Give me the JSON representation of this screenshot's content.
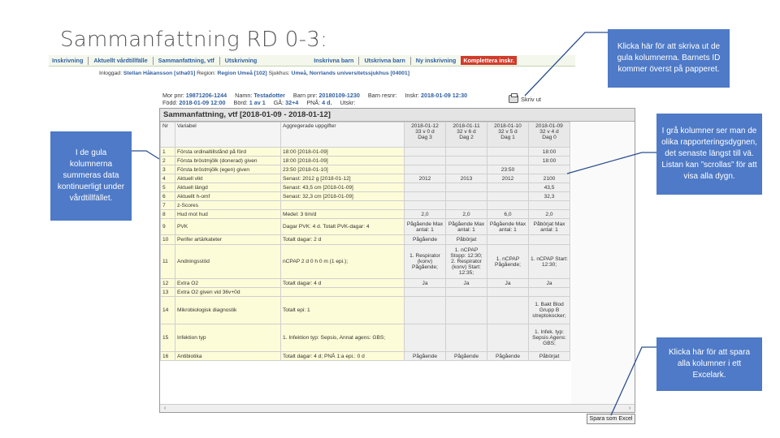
{
  "slide_title": "Sammanfattning RD 0-3:",
  "callouts": {
    "left": "I de gula kolumnerna summeras data kontinuerligt under vårdtillfället.",
    "print": "Klicka här för att skriva ut de gula kolumnerna. Barnets ID kommer överst på papperet.",
    "grey": "I grå kolumner ser man de olika rapporteringsdygnen, det senaste längst till vä. Listan kan ”scrollas” för att visa alla dygn.",
    "excel": "Klicka här för att spara alla kolumner i ett Excelark."
  },
  "menu": {
    "items": [
      "Inskrivning",
      "Aktuellt vårdtillfälle",
      "Sammanfattning, vtf",
      "Utskrivning"
    ],
    "items_right": [
      "Inskrivna barn",
      "Utskrivna barn",
      "Ny inskrivning"
    ],
    "complete": "Komplettera inskr."
  },
  "login": {
    "label": "Inloggad:",
    "user": "Stellan Håkansson [stha01]",
    "region_label": "Region:",
    "region": "Region Umeå [102]",
    "hospital_label": "Sjukhus:",
    "hospital": "Umeå, Norrlands universitetssjukhus [04001]"
  },
  "patient": {
    "mor_label": "Mor pnr:",
    "mor": "19871206-1244",
    "namn_label": "Namn:",
    "namn": "Testadotter",
    "barn_label": "Barn pnr:",
    "barn": "20180109-1230",
    "barn_resnr_label": "Barn resnr:",
    "inskr_label": "Inskr:",
    "inskr": "2018-01-09 12:30",
    "fodd_label": "Född:",
    "fodd": "2018-01-09 12:00",
    "bord_label": "Börd:",
    "bord": "1 av 1",
    "ga_label": "GÅ:",
    "ga": "32+4",
    "pna_label": "PNÅ:",
    "pna": "4 d.",
    "utskr_label": "Utskr:"
  },
  "print_label": "Skriv ut",
  "panel_title": "Sammanfattning, vtf [2018-01-09 - 2018-01-12]",
  "table": {
    "headers": [
      "Nr",
      "Variabel",
      "Aggregerade uppgifter"
    ],
    "days": [
      {
        "date": "2018-01-12",
        "ga": "33 v 0 d",
        "dag": "Dag 3"
      },
      {
        "date": "2018-01-11",
        "ga": "32 v 6 d",
        "dag": "Dag 2"
      },
      {
        "date": "2018-01-10",
        "ga": "32 v 5 d",
        "dag": "Dag 1"
      },
      {
        "date": "2018-01-09",
        "ga": "32 v 4 d",
        "dag": "Dag 0"
      }
    ],
    "rows": [
      {
        "nr": "1",
        "var": "Första ordinaltillstånd på förd",
        "agg": "18:00 [2018-01-09]",
        "d": [
          "",
          "",
          "",
          "18:00"
        ]
      },
      {
        "nr": "2",
        "var": "Första bröstmjölk (donerad) given",
        "agg": "18:00 [2018-01-09]",
        "d": [
          "",
          "",
          "",
          "18:00"
        ]
      },
      {
        "nr": "3",
        "var": "Första bröstmjölk (egen) given",
        "agg": "23:50 [2018-01-10]",
        "d": [
          "",
          "",
          "23:50",
          ""
        ]
      },
      {
        "nr": "4",
        "var": "Aktuell vikt",
        "agg": "Senast: 2012 g [2018-01-12]",
        "d": [
          "2012",
          "2013",
          "2012",
          "2100"
        ]
      },
      {
        "nr": "5",
        "var": "Aktuell längd",
        "agg": "Senast: 43,5 cm [2018-01-09]",
        "d": [
          "",
          "",
          "",
          "43,5"
        ]
      },
      {
        "nr": "6",
        "var": "Aktuellt h-omf",
        "agg": "Senast: 32,3 cm [2018-01-09]",
        "d": [
          "",
          "",
          "",
          "32,3"
        ]
      },
      {
        "nr": "7",
        "var": "z-Scores",
        "agg": "",
        "d": [
          "",
          "",
          "",
          ""
        ]
      },
      {
        "nr": "8",
        "var": "Hud mot hud",
        "agg": "Medel: 3 tim/d",
        "d": [
          "2,0",
          "2,0",
          "6,0",
          "2,0"
        ]
      },
      {
        "nr": "9",
        "var": "PVK",
        "agg": "Dagar PVK: 4 d. Totalt PVK-dagar: 4",
        "d": [
          "Pågående Max antal: 1",
          "Pågående Max antal: 1",
          "Pågående Max antal: 1",
          "Påbörjat Max antal: 1"
        ]
      },
      {
        "nr": "10",
        "var": "Perifer artärkateter",
        "agg": "Totalt dagar: 2 d",
        "d": [
          "Pågående",
          "Påbörjat",
          "",
          ""
        ]
      },
      {
        "nr": "11",
        "var": "Andningsstöd",
        "agg": "nCPAP 2 d 0 h 0 m (1 epi.);",
        "d": [
          "1. Respirator (konv) Pågående;",
          "1. nCPAP Stopp: 12:30; 2. Respirator (konv) Start: 12:35;",
          "1. nCPAP Pågående;",
          "1. nCPAP Start: 12:30;"
        ]
      },
      {
        "nr": "12",
        "var": "Extra O2",
        "agg": "Totalt dagar: 4 d",
        "d": [
          "Ja",
          "Ja",
          "Ja",
          "Ja"
        ]
      },
      {
        "nr": "13",
        "var": "Extra O2 given vid 36v+0d",
        "agg": "",
        "d": [
          "",
          "",
          "",
          ""
        ]
      },
      {
        "nr": "14",
        "var": "Mikrobiologisk diagnostik",
        "agg": "Totalt epi: 1",
        "d": [
          "",
          "",
          "",
          "1. Bakt Blod Grupp B streptokocker;"
        ]
      },
      {
        "nr": "15",
        "var": "Infektion typ",
        "agg": "1. Infektion typ: Sepsis, Annat agens: GBS;",
        "d": [
          "",
          "",
          "",
          "1. Infek. typ: Sepsis Agens: GBS;"
        ]
      },
      {
        "nr": "16",
        "var": "Antibiotika",
        "agg": "Totalt dagar: 4 d; PNÅ 1:a epi.: 0 d",
        "d": [
          "Pågående",
          "Pågående",
          "Pågående",
          "Påbörjat"
        ]
      }
    ]
  },
  "excel_button": "Spara som Excel",
  "colors": {
    "callout": "#4e7ac7",
    "yellow": "#fdfcd8",
    "grey": "#efefef",
    "link": "#2f5fa0",
    "alert": "#d03b2a"
  }
}
